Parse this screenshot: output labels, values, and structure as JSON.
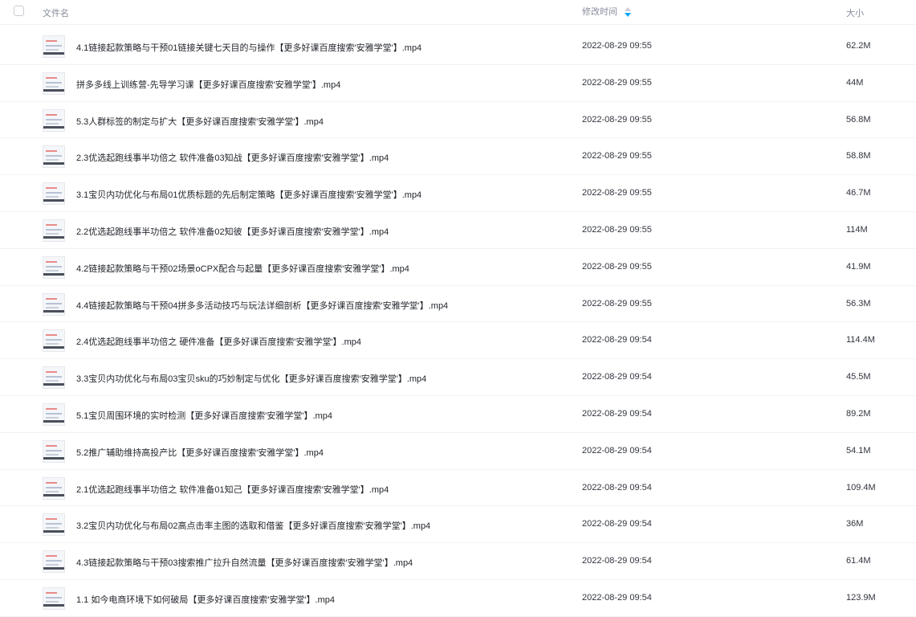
{
  "header": {
    "name_label": "文件名",
    "time_label": "修改时间",
    "size_label": "大小",
    "sort_icon": "sort-desc-icon",
    "sort_color": "#06a7ff"
  },
  "files": [
    {
      "name": "4.1链接起款策略与干预01链接关键七天目的与操作【更多好课百度搜索'安雅学堂'】.mp4",
      "time": "2022-08-29 09:55",
      "size": "62.2M"
    },
    {
      "name": "拼多多线上训练营-先导学习课【更多好课百度搜索'安雅学堂'】.mp4",
      "time": "2022-08-29 09:55",
      "size": "44M"
    },
    {
      "name": "5.3人群标签的制定与扩大【更多好课百度搜索'安雅学堂'】.mp4",
      "time": "2022-08-29 09:55",
      "size": "56.8M"
    },
    {
      "name": "2.3优选起跑线事半功倍之 软件准备03知战【更多好课百度搜索'安雅学堂'】.mp4",
      "time": "2022-08-29 09:55",
      "size": "58.8M"
    },
    {
      "name": "3.1宝贝内功优化与布局01优质标题的先后制定策略【更多好课百度搜索'安雅学堂'】.mp4",
      "time": "2022-08-29 09:55",
      "size": "46.7M"
    },
    {
      "name": "2.2优选起跑线事半功倍之 软件准备02知彼【更多好课百度搜索'安雅学堂'】.mp4",
      "time": "2022-08-29 09:55",
      "size": "114M"
    },
    {
      "name": "4.2链接起款策略与干预02场景oCPX配合与起量【更多好课百度搜索'安雅学堂'】.mp4",
      "time": "2022-08-29 09:55",
      "size": "41.9M"
    },
    {
      "name": "4.4链接起款策略与干预04拼多多活动技巧与玩法详细剖析【更多好课百度搜索'安雅学堂'】.mp4",
      "time": "2022-08-29 09:55",
      "size": "56.3M"
    },
    {
      "name": "2.4优选起跑线事半功倍之 硬件准备【更多好课百度搜索'安雅学堂'】.mp4",
      "time": "2022-08-29 09:54",
      "size": "114.4M"
    },
    {
      "name": "3.3宝贝内功优化与布局03宝贝sku的巧妙制定与优化【更多好课百度搜索'安雅学堂'】.mp4",
      "time": "2022-08-29 09:54",
      "size": "45.5M"
    },
    {
      "name": "5.1宝贝周围环境的实时检测【更多好课百度搜索'安雅学堂'】.mp4",
      "time": "2022-08-29 09:54",
      "size": "89.2M"
    },
    {
      "name": "5.2推广辅助维持高投产比【更多好课百度搜索'安雅学堂'】.mp4",
      "time": "2022-08-29 09:54",
      "size": "54.1M"
    },
    {
      "name": "2.1优选起跑线事半功倍之 软件准备01知己【更多好课百度搜索'安雅学堂'】.mp4",
      "time": "2022-08-29 09:54",
      "size": "109.4M"
    },
    {
      "name": "3.2宝贝内功优化与布局02高点击率主图的选取和借鉴【更多好课百度搜索'安雅学堂'】.mp4",
      "time": "2022-08-29 09:54",
      "size": "36M"
    },
    {
      "name": "4.3链接起款策略与干预03搜索推广拉升自然流量【更多好课百度搜索'安雅学堂'】.mp4",
      "time": "2022-08-29 09:54",
      "size": "61.4M"
    },
    {
      "name": "1.1 如今电商环境下如何破局【更多好课百度搜索'安雅学堂'】.mp4",
      "time": "2022-08-29 09:54",
      "size": "123.9M"
    }
  ]
}
